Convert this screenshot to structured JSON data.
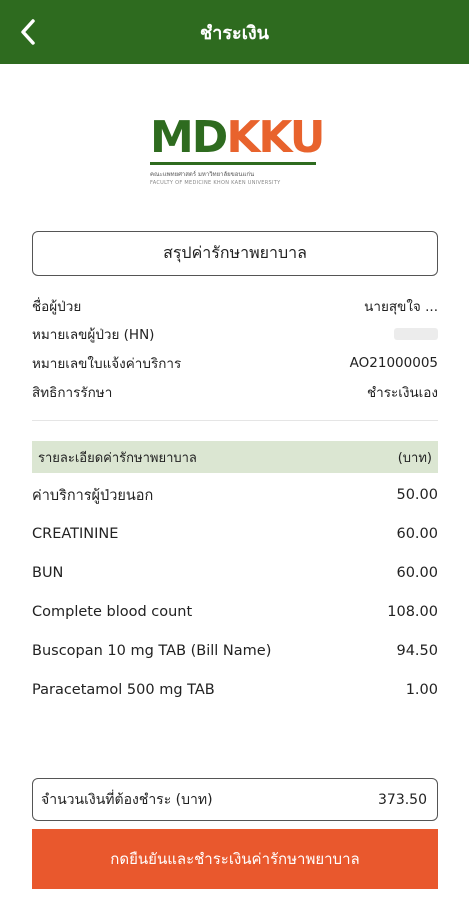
{
  "header": {
    "title": "ชำระเงิน",
    "back_icon": "chevron-left-icon",
    "background": "#2e6b1f"
  },
  "logo": {
    "letters_md": "MD",
    "letters_kku": "KKU",
    "subtitle": "คณะแพทยศาสตร์ มหาวิทยาลัยขอนแก่น",
    "subtitle_en": "FACULTY OF MEDICINE KHON KAEN UNIVERSITY",
    "green": "#2e6b1f",
    "orange": "#e8632d"
  },
  "summary_title": "สรุปค่ารักษาพยาบาล",
  "patient": {
    "name_label": "ชื่อผู้ป่วย",
    "name_value": "นายสุขใจ ...",
    "hn_label": "หมายเลขผู้ป่วย (HN)",
    "invoice_label": "หมายเลขใบแจ้งค่าบริการ",
    "invoice_value": "AO21000005",
    "right_label": "สิทธิการรักษา",
    "right_value": "ชำระเงินเอง"
  },
  "details": {
    "header_label": "รายละเอียดค่ารักษาพยาบาล",
    "header_unit": "(บาท)",
    "items": [
      {
        "name": "ค่าบริการผู้ป่วยนอก",
        "amount": "50.00"
      },
      {
        "name": "CREATININE",
        "amount": "60.00"
      },
      {
        "name": "BUN",
        "amount": "60.00"
      },
      {
        "name": "Complete blood count",
        "amount": "108.00"
      },
      {
        "name": "Buscopan 10 mg TAB (Bill Name)",
        "amount": "94.50"
      },
      {
        "name": "Paracetamol 500 mg TAB",
        "amount": "1.00"
      }
    ]
  },
  "total": {
    "label": "จำนวนเงินที่ต้องชำระ (บาท)",
    "value": "373.50"
  },
  "confirm_button": {
    "label": "กดยืนยันและชำระเงินค่ารักษาพยาบาล",
    "color": "#e9582d"
  }
}
